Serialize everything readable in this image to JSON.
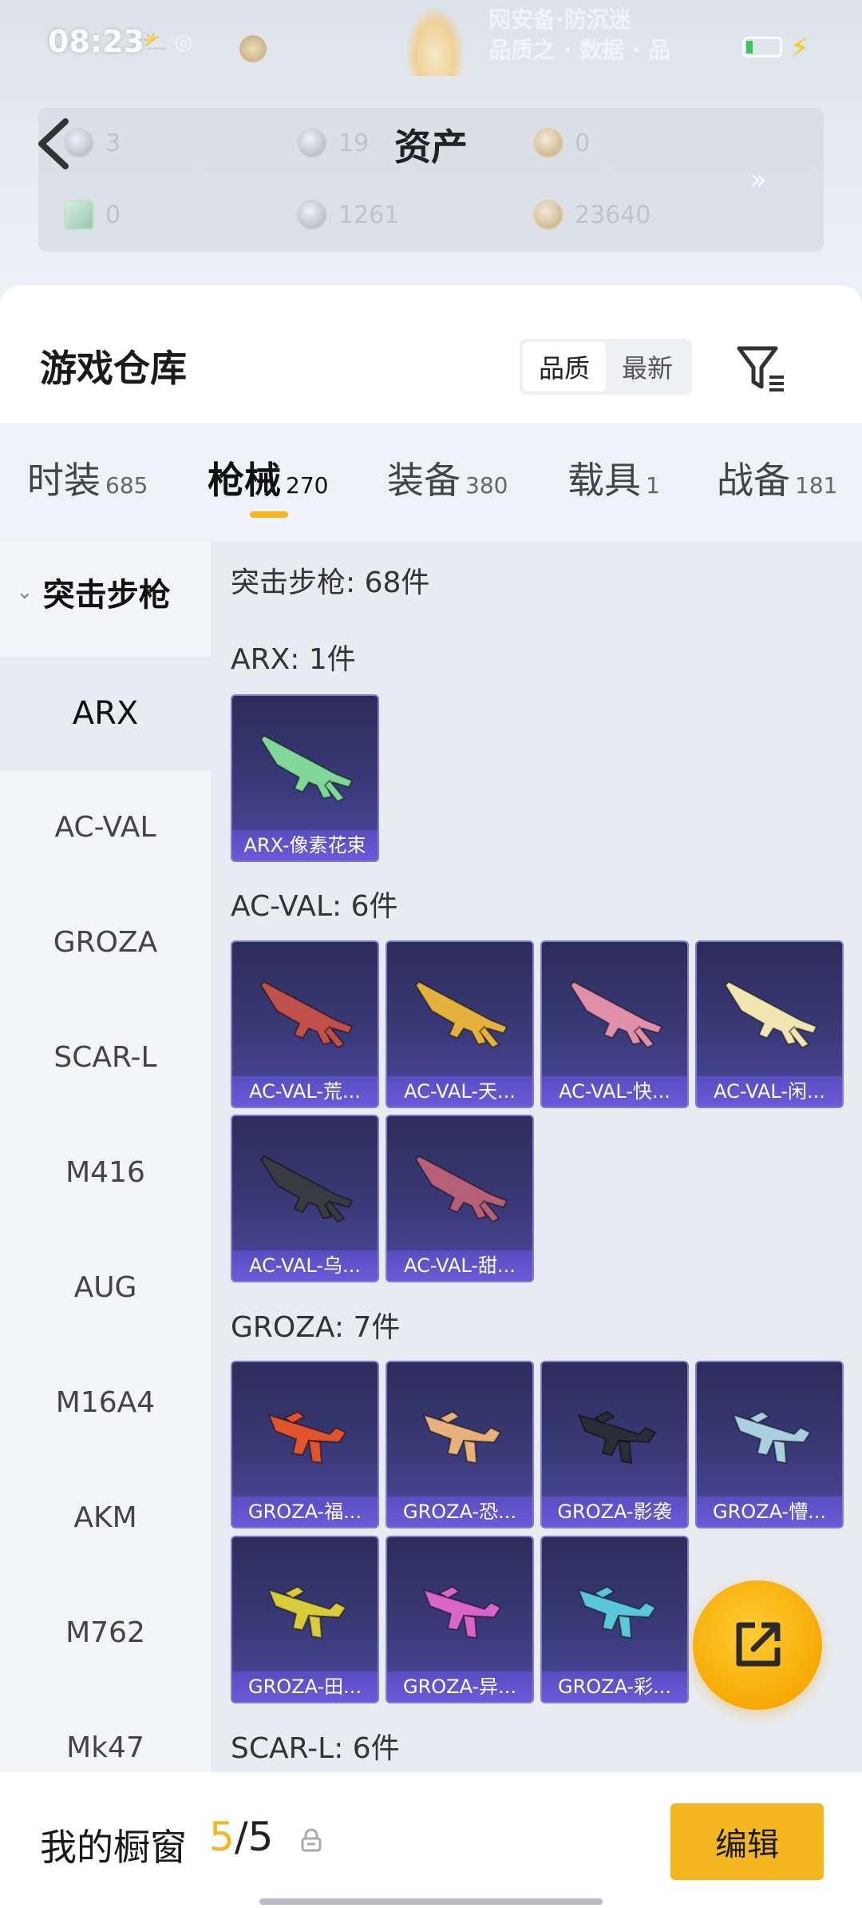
{
  "status_bar": {
    "time": "08:23",
    "misc": "⛅ ◎",
    "noise_line1": "网安备·防沉迷",
    "noise_line2": "品质之 · 数据 · 品"
  },
  "header": {
    "back_icon": "chevron-left-icon",
    "title": "资产",
    "assets": [
      {
        "icon": "ticket-coin",
        "value": "3"
      },
      {
        "icon": "silver-coin",
        "value": "19"
      },
      {
        "icon": "gold-coin",
        "value": "0"
      },
      {
        "icon": "green-card-coin",
        "value": "0"
      },
      {
        "icon": "white-coin",
        "value": "1261"
      },
      {
        "icon": "bronze-coin",
        "value": "23640"
      }
    ],
    "more_icon": "double-chevron-right-icon",
    "more_glyph": "»"
  },
  "warehouse": {
    "title": "游戏仓库",
    "sort_options": [
      "品质",
      "最新"
    ],
    "sort_active": "品质",
    "filter_icon": "filter-icon"
  },
  "tabs": [
    {
      "label": "时装",
      "count": "685"
    },
    {
      "label": "枪械",
      "count": "270",
      "active": true
    },
    {
      "label": "装备",
      "count": "380"
    },
    {
      "label": "载具",
      "count": "1"
    },
    {
      "label": "战备",
      "count": "181"
    }
  ],
  "sidebar": {
    "header": "突击步枪",
    "expand_glyph": "⌄",
    "items": [
      "ARX",
      "AC-VAL",
      "GROZA",
      "SCAR-L",
      "M416",
      "AUG",
      "M16A4",
      "AKM",
      "M762",
      "Mk47"
    ],
    "active": "ARX"
  },
  "content": {
    "total": "突击步枪: 68件",
    "groups": [
      {
        "title": "ARX: 1件",
        "items": [
          {
            "label": "ARX-像素花束",
            "color": "#7fd89a"
          }
        ]
      },
      {
        "title": "AC-VAL: 6件",
        "items": [
          {
            "label": "AC-VAL-荒...",
            "color": "#c0504a"
          },
          {
            "label": "AC-VAL-天...",
            "color": "#e4b13c"
          },
          {
            "label": "AC-VAL-快...",
            "color": "#e090a8"
          },
          {
            "label": "AC-VAL-闲...",
            "color": "#f1e6b2"
          },
          {
            "label": "AC-VAL-乌...",
            "color": "#3a3a42"
          },
          {
            "label": "AC-VAL-甜...",
            "color": "#b56078"
          }
        ]
      },
      {
        "title": "GROZA: 7件",
        "items": [
          {
            "label": "GROZA-福...",
            "color": "#e0532c"
          },
          {
            "label": "GROZA-恐...",
            "color": "#e8b07a"
          },
          {
            "label": "GROZA-影袭",
            "color": "#2a2c36"
          },
          {
            "label": "GROZA-懵...",
            "color": "#a9d0e0"
          },
          {
            "label": "GROZA-田...",
            "color": "#d8cc3a"
          },
          {
            "label": "GROZA-异...",
            "color": "#d866c8"
          },
          {
            "label": "GROZA-彩...",
            "color": "#5ac8d8"
          }
        ]
      },
      {
        "title": "SCAR-L: 6件",
        "items": []
      }
    ]
  },
  "fab": {
    "icon": "share-icon"
  },
  "bottom": {
    "showcase_label": "我的橱窗",
    "showcase_used": "5",
    "showcase_total": "/5",
    "lock_icon": "lock-icon",
    "edit_label": "编辑"
  },
  "colors": {
    "accent": "#f5b71f",
    "tile_bg": "#3a3a78",
    "tile_border": "#7c7cd6",
    "caption_bg": "#6a5ad8"
  }
}
